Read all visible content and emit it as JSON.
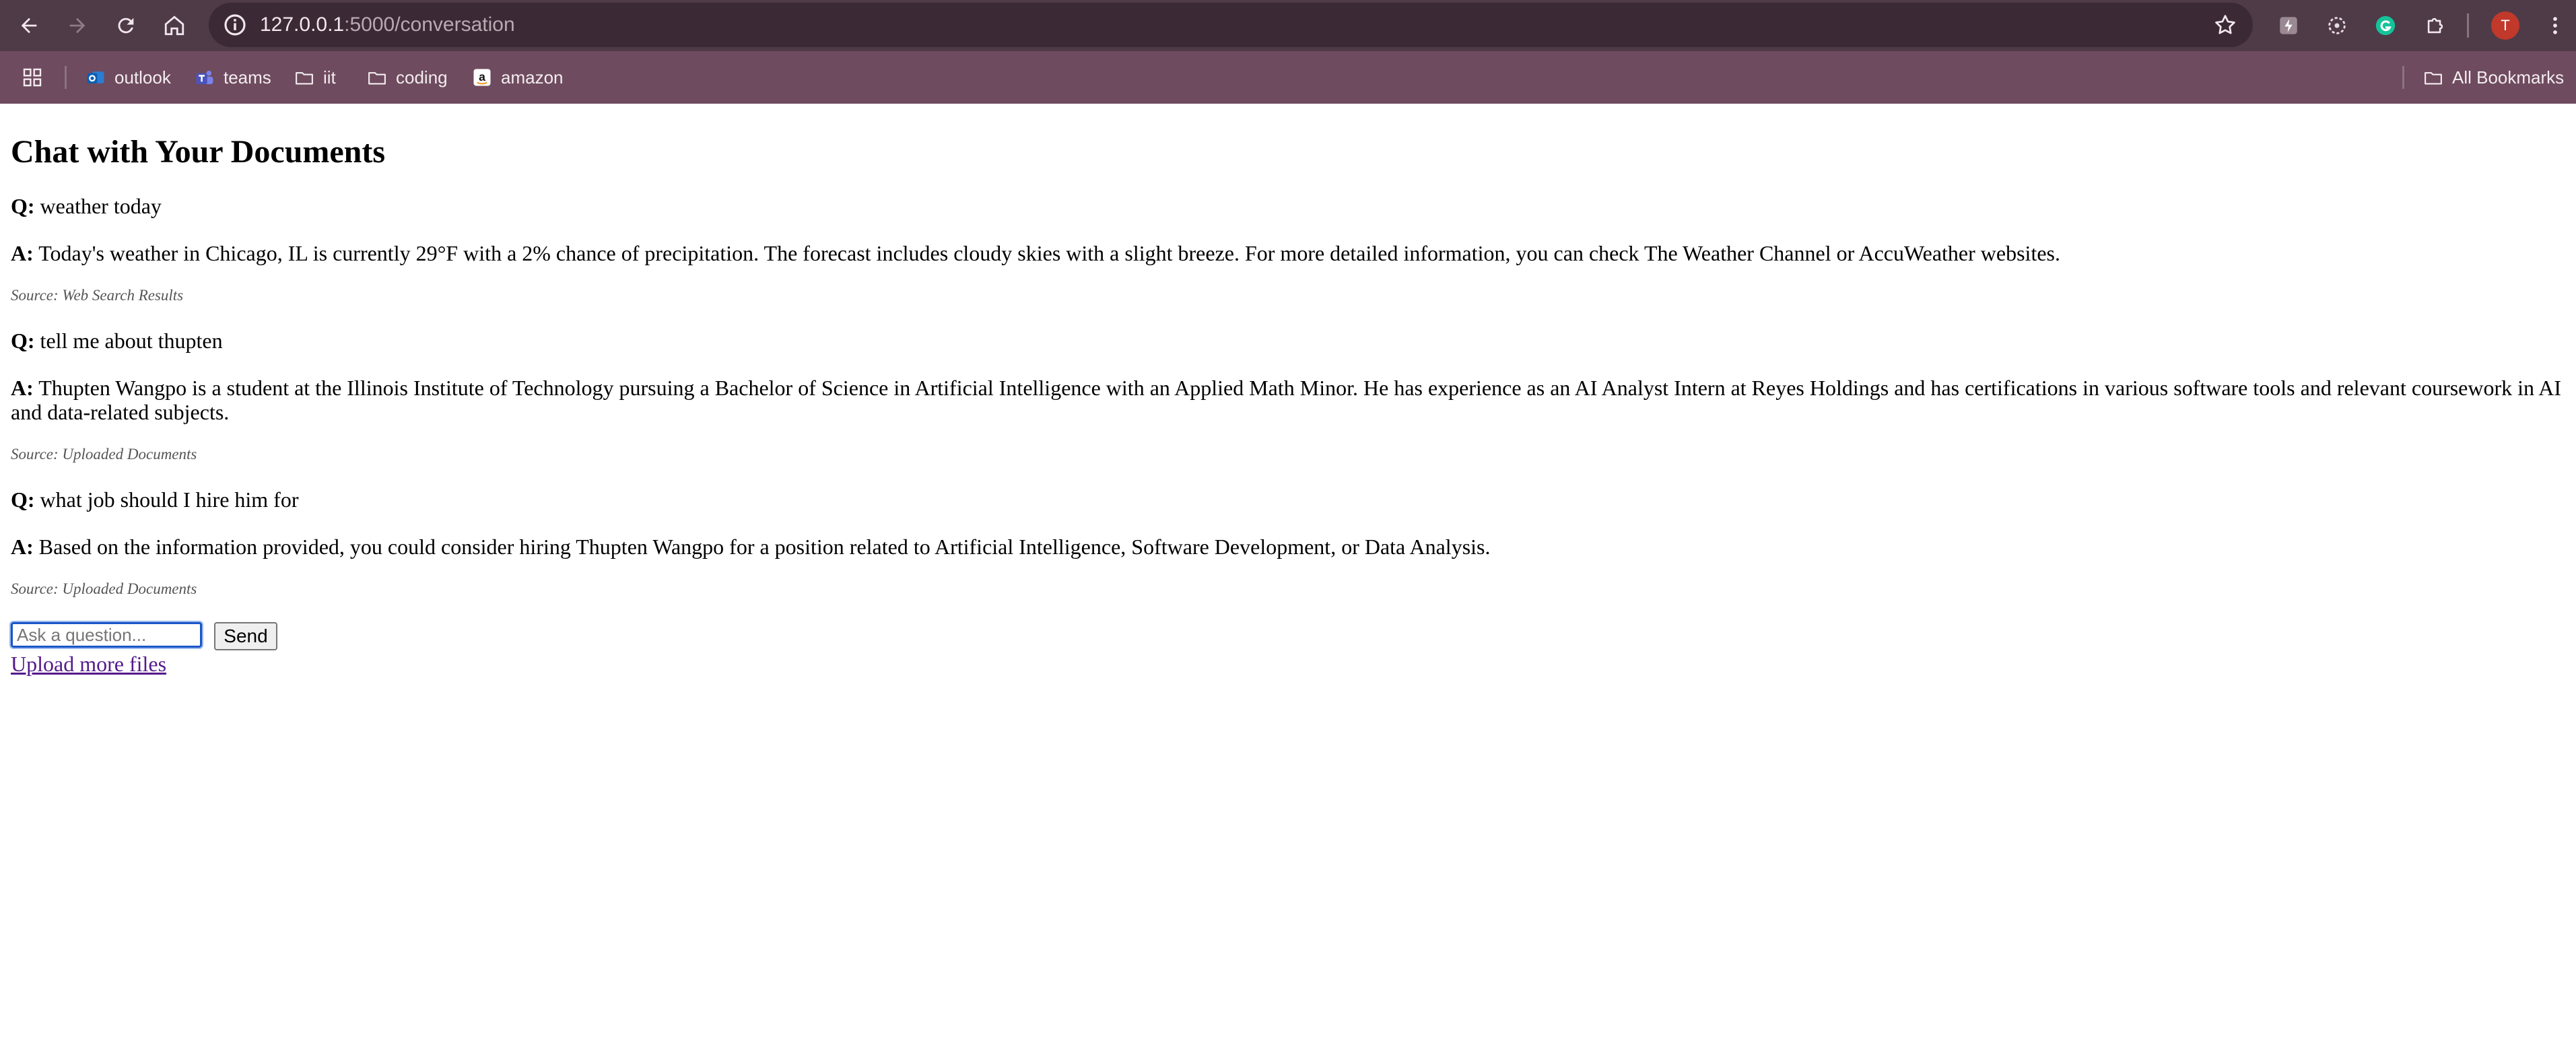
{
  "browser": {
    "url_host": "127.0.0.1",
    "url_path": ":5000/conversation",
    "avatar_letter": "T",
    "bookmarks": [
      {
        "label": "outlook",
        "icon": "outlook-icon"
      },
      {
        "label": "teams",
        "icon": "teams-icon"
      },
      {
        "label": "iit",
        "icon": "folder-icon"
      },
      {
        "label": "coding",
        "icon": "folder-icon"
      },
      {
        "label": "amazon",
        "icon": "amazon-icon"
      }
    ],
    "all_bookmarks_label": "All Bookmarks",
    "colors": {
      "toolbar": "#4f3a47",
      "bookmarks_bar": "#6e4b5e",
      "avatar": "#c0392b"
    }
  },
  "page": {
    "title": "Chat with Your Documents",
    "q_label": "Q:",
    "a_label": "A:",
    "conversation": [
      {
        "question": "weather today",
        "answer": "Today's weather in Chicago, IL is currently 29°F with a 2% chance of precipitation. The forecast includes cloudy skies with a slight breeze. For more detailed information, you can check The Weather Channel or AccuWeather websites.",
        "source": "Source: Web Search Results"
      },
      {
        "question": "tell me about thupten",
        "answer": "Thupten Wangpo is a student at the Illinois Institute of Technology pursuing a Bachelor of Science in Artificial Intelligence with an Applied Math Minor. He has experience as an AI Analyst Intern at Reyes Holdings and has certifications in various software tools and relevant coursework in AI and data-related subjects.",
        "source": "Source: Uploaded Documents"
      },
      {
        "question": "what job should I hire him for",
        "answer": "Based on the information provided, you could consider hiring Thupten Wangpo for a position related to Artificial Intelligence, Software Development, or Data Analysis.",
        "source": "Source: Uploaded Documents"
      }
    ],
    "input_placeholder": "Ask a question...",
    "send_label": "Send",
    "upload_link": "Upload more files"
  }
}
